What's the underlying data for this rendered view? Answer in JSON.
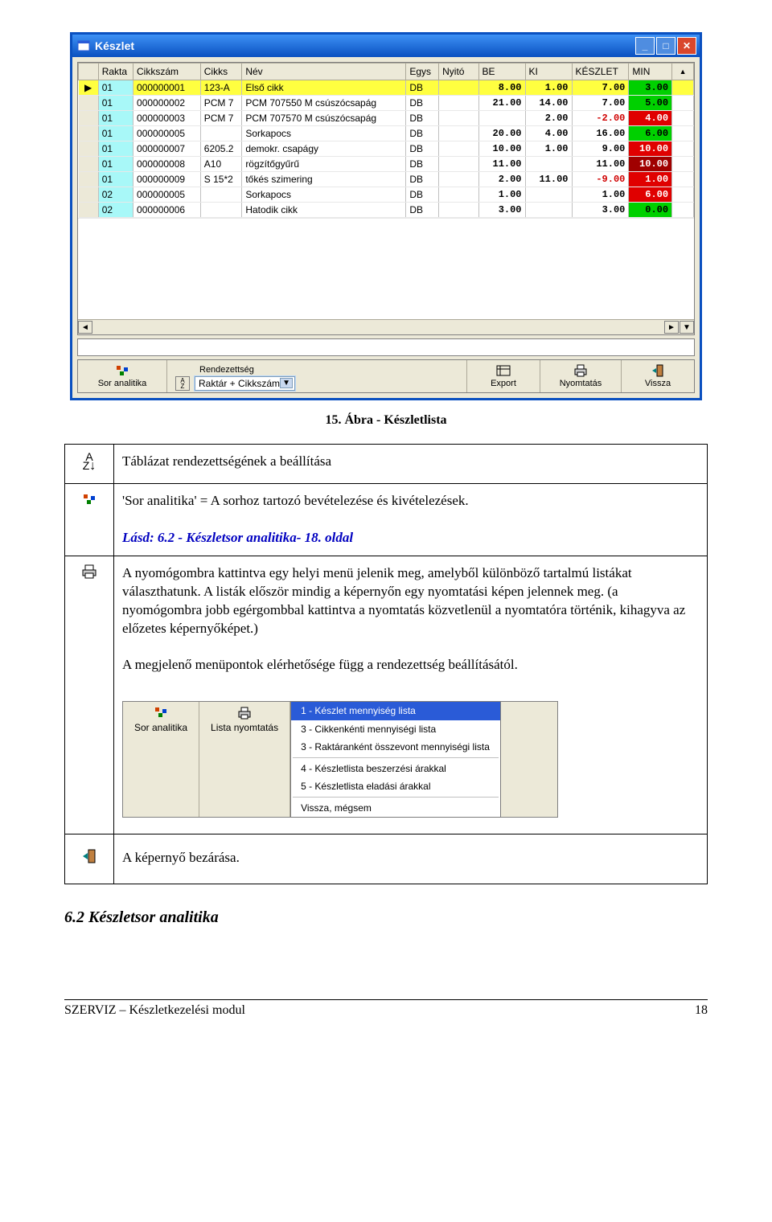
{
  "win": {
    "title": "Készlet",
    "cols": [
      "Rakta",
      "Cikkszám",
      "Cikks",
      "Név",
      "Egys",
      "Nyitó",
      "BE",
      "KI",
      "KÉSZLET",
      "MIN"
    ],
    "rows": [
      {
        "ptr": "▶",
        "r": "01",
        "c": "000000001",
        "cs": "123-A",
        "n": "Első cikk",
        "e": "DB",
        "ny": "",
        "be": "8.00",
        "ki": "1.00",
        "ke": "7.00",
        "keNeg": false,
        "min": "3.00",
        "minCls": "greenCell",
        "sel": true
      },
      {
        "ptr": "",
        "r": "01",
        "c": "000000002",
        "cs": "PCM 7",
        "n": "PCM 707550 M csúszócsapág",
        "e": "DB",
        "ny": "",
        "be": "21.00",
        "ki": "14.00",
        "ke": "7.00",
        "keNeg": false,
        "min": "5.00",
        "minCls": "greenCell"
      },
      {
        "ptr": "",
        "r": "01",
        "c": "000000003",
        "cs": "PCM 7",
        "n": "PCM 707570 M csúszócsapág",
        "e": "DB",
        "ny": "",
        "be": "",
        "ki": "2.00",
        "ke": "-2.00",
        "keNeg": true,
        "min": "4.00",
        "minCls": "redCell"
      },
      {
        "ptr": "",
        "r": "01",
        "c": "000000005",
        "cs": "",
        "n": "Sorkapocs",
        "e": "DB",
        "ny": "",
        "be": "20.00",
        "ki": "4.00",
        "ke": "16.00",
        "keNeg": false,
        "min": "6.00",
        "minCls": "greenCell"
      },
      {
        "ptr": "",
        "r": "01",
        "c": "000000007",
        "cs": "6205.2",
        "n": "demokr. csapágy",
        "e": "DB",
        "ny": "",
        "be": "10.00",
        "ki": "1.00",
        "ke": "9.00",
        "keNeg": false,
        "min": "10.00",
        "minCls": "redCell"
      },
      {
        "ptr": "",
        "r": "01",
        "c": "000000008",
        "cs": "A10",
        "n": "rögzítőgyűrű",
        "e": "DB",
        "ny": "",
        "be": "11.00",
        "ki": "",
        "ke": "11.00",
        "keNeg": false,
        "min": "10.00",
        "minCls": "darkRedCell"
      },
      {
        "ptr": "",
        "r": "01",
        "c": "000000009",
        "cs": "S 15*2",
        "n": "tőkés szimering",
        "e": "DB",
        "ny": "",
        "be": "2.00",
        "ki": "11.00",
        "ke": "-9.00",
        "keNeg": true,
        "min": "1.00",
        "minCls": "redCell"
      },
      {
        "ptr": "",
        "r": "02",
        "c": "000000005",
        "cs": "",
        "n": "Sorkapocs",
        "e": "DB",
        "ny": "",
        "be": "1.00",
        "ki": "",
        "ke": "1.00",
        "keNeg": false,
        "min": "6.00",
        "minCls": "redCell"
      },
      {
        "ptr": "",
        "r": "02",
        "c": "000000006",
        "cs": "",
        "n": "Hatodik cikk",
        "e": "DB",
        "ny": "",
        "be": "3.00",
        "ki": "",
        "ke": "3.00",
        "keNeg": false,
        "min": "0.00",
        "minCls": "greenCell"
      }
    ],
    "toolbar": {
      "sor": "Sor analitika",
      "rendLabel": "Rendezettség",
      "rendValue": "Raktár + Cikkszám",
      "export": "Export",
      "nyom": "Nyomtatás",
      "vissza": "Vissza"
    }
  },
  "caption": "15. Ábra - Készletlista",
  "desc": {
    "row1": "Táblázat rendezettségének a beállítása",
    "row2a": "'Sor analitika' = A sorhoz tartozó bevételezése és kivételezések.",
    "row2b": "Lásd: 6.2 - Készletsor analitika- 18. oldal",
    "row3a": "A nyomógombra kattintva egy helyi menü jelenik meg, amelyből különböző tartalmú listákat választhatunk. A listák először mindig a képernyőn egy nyomtatási képen jelennek meg. (a nyomógombra jobb egérgombbal kattintva a nyomtatás közvetlenül a nyomtatóra történik, kihagyva az előzetes képernyőképet.)",
    "row3b": "A megjelenő menüpontok elérhetősége függ a rendezettség beállításától.",
    "ctx": {
      "sor": "Sor analitika",
      "lista": "Lista nyomtatás",
      "m1": "1 - Készlet mennyiség lista",
      "m2": "3 - Cikkenkénti mennyiségi lista",
      "m3": "3 - Raktáranként összevont mennyiségi lista",
      "m4": "4 - Készletlista beszerzési árakkal",
      "m5": "5 - Készletlista eladási árakkal",
      "m6": "Vissza, mégsem"
    },
    "row4": "A képernyő bezárása."
  },
  "section": "6.2  Készletsor analitika",
  "footer": {
    "left": "SZERVIZ – Készletkezelési modul",
    "right": "18"
  }
}
